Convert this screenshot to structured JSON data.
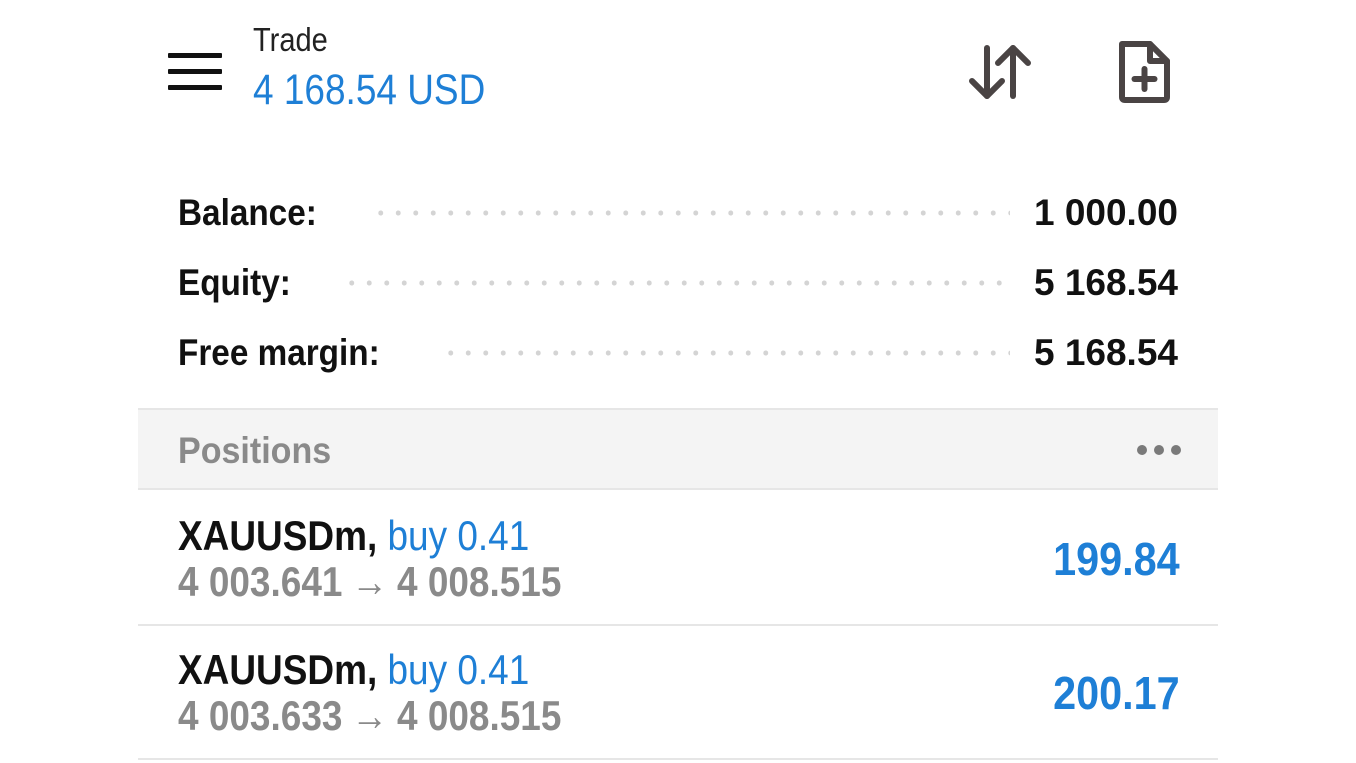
{
  "header": {
    "title": "Trade",
    "total": "4 168.54 USD"
  },
  "summary": [
    {
      "label": "Balance:",
      "value": "1 000.00"
    },
    {
      "label": "Equity:",
      "value": "5 168.54"
    },
    {
      "label": "Free margin:",
      "value": "5 168.54"
    }
  ],
  "positions": {
    "title": "Positions",
    "items": [
      {
        "symbol": "XAUUSDm",
        "side": "buy 0.41",
        "open": "4 003.641",
        "arrow": "→",
        "current": "4 008.515",
        "profit": "199.84"
      },
      {
        "symbol": "XAUUSDm",
        "side": "buy 0.41",
        "open": "4 003.633",
        "arrow": "→",
        "current": "4 008.515",
        "profit": "200.17"
      }
    ]
  },
  "colors": {
    "accent": "#1e7fd6",
    "label_gray": "#8a8a8a",
    "section_bg": "#f4f4f4",
    "icon": "#4a4444"
  },
  "icons": {
    "menu": "hamburger-menu-icon",
    "sort": "sort-arrows-icon",
    "new_order": "new-document-plus-icon",
    "more": "more-dots-icon"
  }
}
